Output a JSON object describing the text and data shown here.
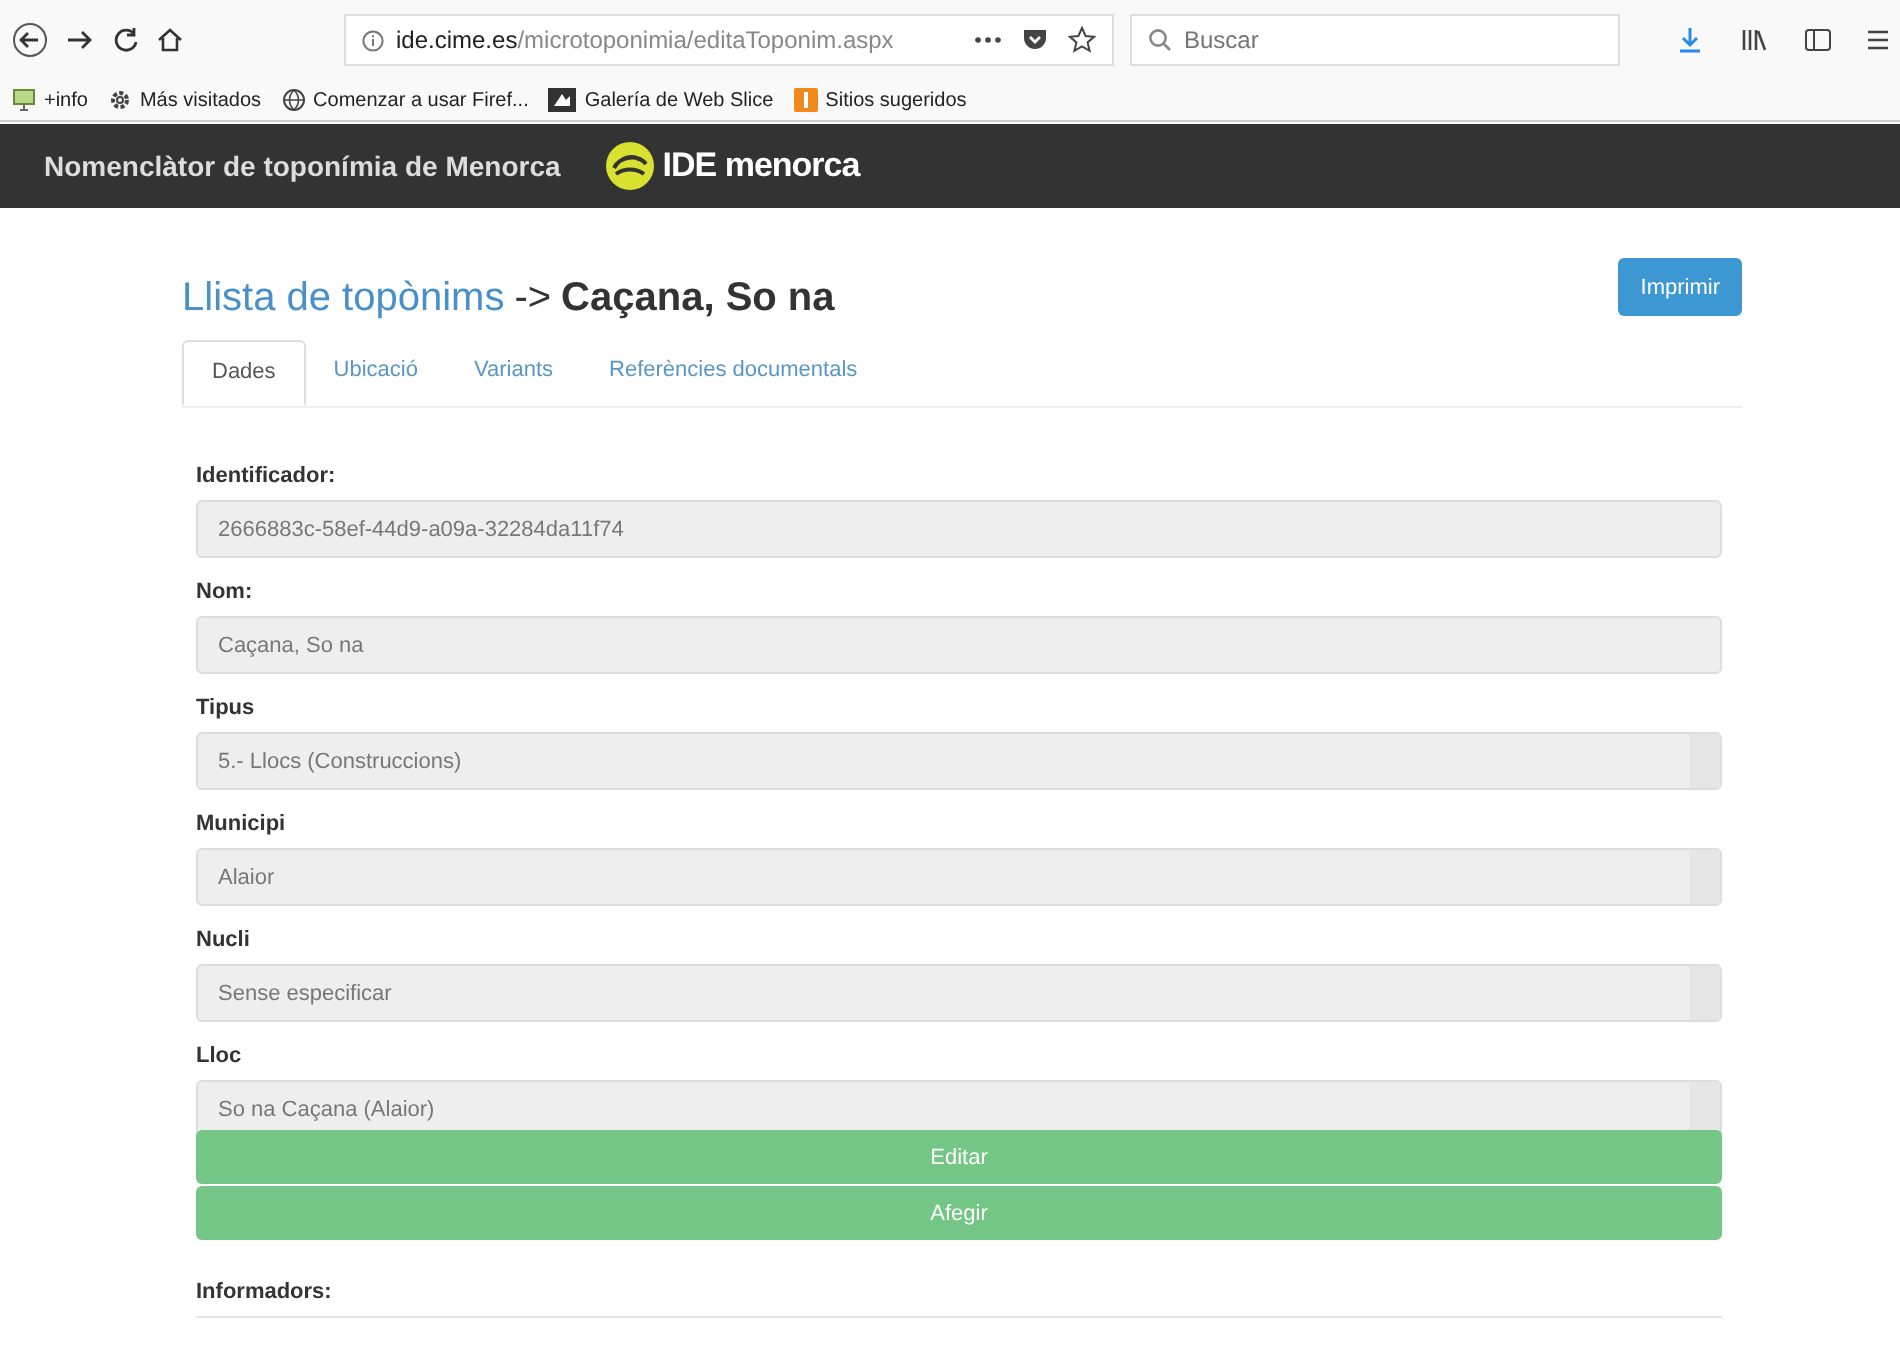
{
  "browser": {
    "url_host": "ide.cime.es",
    "url_path": "/microtoponimia/editaToponim.aspx",
    "search_placeholder": "Buscar",
    "bookmarks": [
      {
        "label": "+info",
        "kind": "monitor"
      },
      {
        "label": "Más visitados",
        "kind": "gear"
      },
      {
        "label": "Comenzar a usar Firef...",
        "kind": "globe"
      },
      {
        "label": "Galería de Web Slice",
        "kind": "slice"
      },
      {
        "label": "Sitios sugeridos",
        "kind": "orange"
      }
    ]
  },
  "header": {
    "title": "Nomenclàtor de toponímia de Menorca",
    "logo_text": "IDE menorca"
  },
  "page": {
    "breadcrumb_link": "Llista de topònims",
    "breadcrumb_sep": "->",
    "heading": "Caçana, So na",
    "print_button": "Imprimir"
  },
  "tabs": [
    {
      "label": "Dades",
      "selected": true
    },
    {
      "label": "Ubicació",
      "selected": false
    },
    {
      "label": "Variants",
      "selected": false
    },
    {
      "label": "Referències documentals",
      "selected": false
    }
  ],
  "fields": [
    {
      "label": "Identificador:",
      "kind": "text",
      "value": "2666883c-58ef-44d9-a09a-32284da11f74"
    },
    {
      "label": "Nom:",
      "kind": "text",
      "value": "Caçana, So na"
    },
    {
      "label": "Tipus",
      "kind": "select",
      "value": "5.- Llocs (Construccions)"
    },
    {
      "label": "Municipi",
      "kind": "select",
      "value": "Alaior"
    },
    {
      "label": "Nucli",
      "kind": "select",
      "value": "Sense especificar"
    },
    {
      "label": "Lloc",
      "kind": "select",
      "value": "So na Caçana (Alaior)"
    }
  ],
  "actions": [
    "Editar",
    "Afegir"
  ],
  "next_label": "Informadors:"
}
